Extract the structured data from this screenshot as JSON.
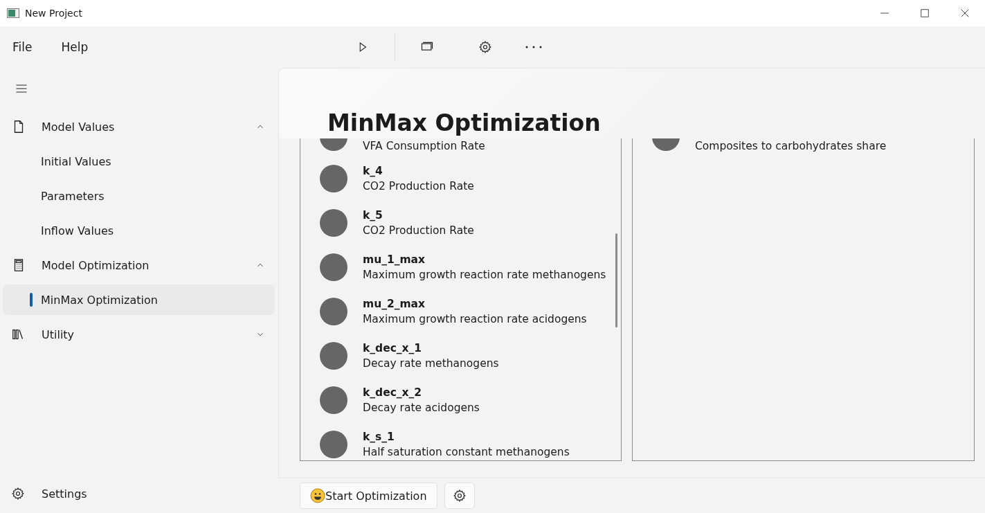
{
  "window": {
    "title": "New Project"
  },
  "menu": [
    "File",
    "Help"
  ],
  "sidebar": {
    "items": [
      {
        "label": "Model Values",
        "expanded": true,
        "children": [
          {
            "label": "Initial Values",
            "selected": false
          },
          {
            "label": "Parameters",
            "selected": false
          },
          {
            "label": "Inflow Values",
            "selected": false
          }
        ]
      },
      {
        "label": "Model Optimization",
        "expanded": true,
        "children": [
          {
            "label": "MinMax Optimization",
            "selected": true
          }
        ]
      },
      {
        "label": "Utility",
        "expanded": false
      }
    ],
    "footer": {
      "label": "Settings"
    }
  },
  "page": {
    "title": "MinMax Optimization",
    "left_list": {
      "partial_top": {
        "description": "VFA Consumption Rate"
      },
      "items": [
        {
          "name": "k_4",
          "description": "CO2 Production Rate"
        },
        {
          "name": "k_5",
          "description": "CO2 Production Rate"
        },
        {
          "name": "mu_1_max",
          "description": "Maximum growth reaction rate methanogens"
        },
        {
          "name": "mu_2_max",
          "description": "Maximum growth reaction rate acidogens"
        },
        {
          "name": "k_dec_x_1",
          "description": "Decay rate methanogens"
        },
        {
          "name": "k_dec_x_2",
          "description": "Decay rate acidogens"
        },
        {
          "name": "k_s_1",
          "description": "Half saturation constant methanogens"
        }
      ]
    },
    "right_list": {
      "partial_top": {
        "description": "Composites to carbohydrates share"
      }
    }
  },
  "actions": {
    "start_button": "Start Optimization"
  }
}
